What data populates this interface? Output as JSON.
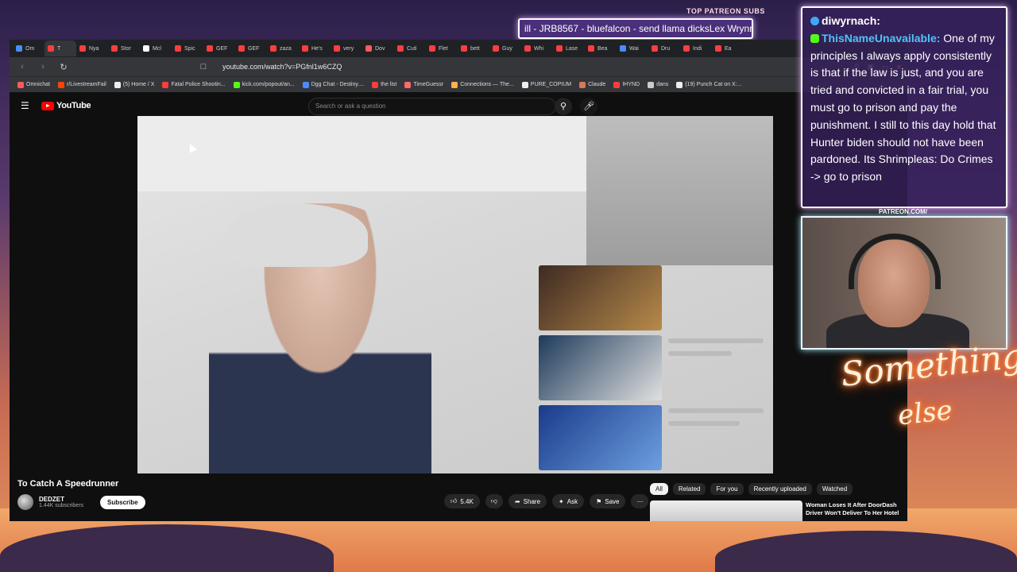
{
  "overlay": {
    "ticker_label": "TOP PATREON SUBS",
    "ticker_text": "ill - JRB8567 - bluefalcon - send llama dicksLex Wrynn -",
    "chat": {
      "user1": "diwyrnach:",
      "user2": "ThisNameUnavailable:",
      "message": "One of my principles I always apply consistently is that if the law is just, and you are tried and convicted in a fair trial, you must go to prison and pay the punishment. I still to this day hold that Hunter biden should not have been pardoned. Its Shrimpleas: Do Crimes -> go to prison"
    },
    "patreon_tag": "PATREON.COM/",
    "neon_line1": "Something",
    "neon_line2": "else"
  },
  "browser": {
    "tabs": [
      "Om",
      "T",
      "Nya",
      "Stor",
      "Mcl",
      "Spic",
      "GEF",
      "GEF",
      "zaza",
      "He's",
      "very",
      "Dov",
      "Cuti",
      "Flet",
      "bett",
      "Guy",
      "Whi",
      "Lase",
      "Bea",
      "Wai",
      "Dru",
      "Indi",
      "Ea"
    ],
    "url": "youtube.com/watch?v=PGfnl1w6CZQ",
    "bookmarks": [
      "Omnichat",
      "r/LivestreamFail",
      "(5) Home / X",
      "Fatal Police Shootin...",
      "kick.com/popout/an...",
      "Dgg Chat - Destiny....",
      "the list",
      "TimeGuessr",
      "Connections — The...",
      "PURE_COPIUM",
      "Claude",
      "IHYND",
      "dans",
      "(19) Punch Cat on X:..."
    ]
  },
  "youtube": {
    "logo": "YouTube",
    "search_placeholder": "Search or ask a question",
    "video_title": "To Catch A Speedrunner",
    "channel_name": "DEDZET",
    "subscribers": "1.44K subscribers",
    "subscribe_label": "Subscribe",
    "likes": "5.4K",
    "share_label": "Share",
    "ask_label": "Ask",
    "save_label": "Save",
    "chips": [
      "All",
      "Related",
      "For you",
      "Recently uploaded",
      "Watched"
    ],
    "rec_title": "Woman Loses It After DoorDash Driver Won't Deliver To Her Hotel"
  }
}
